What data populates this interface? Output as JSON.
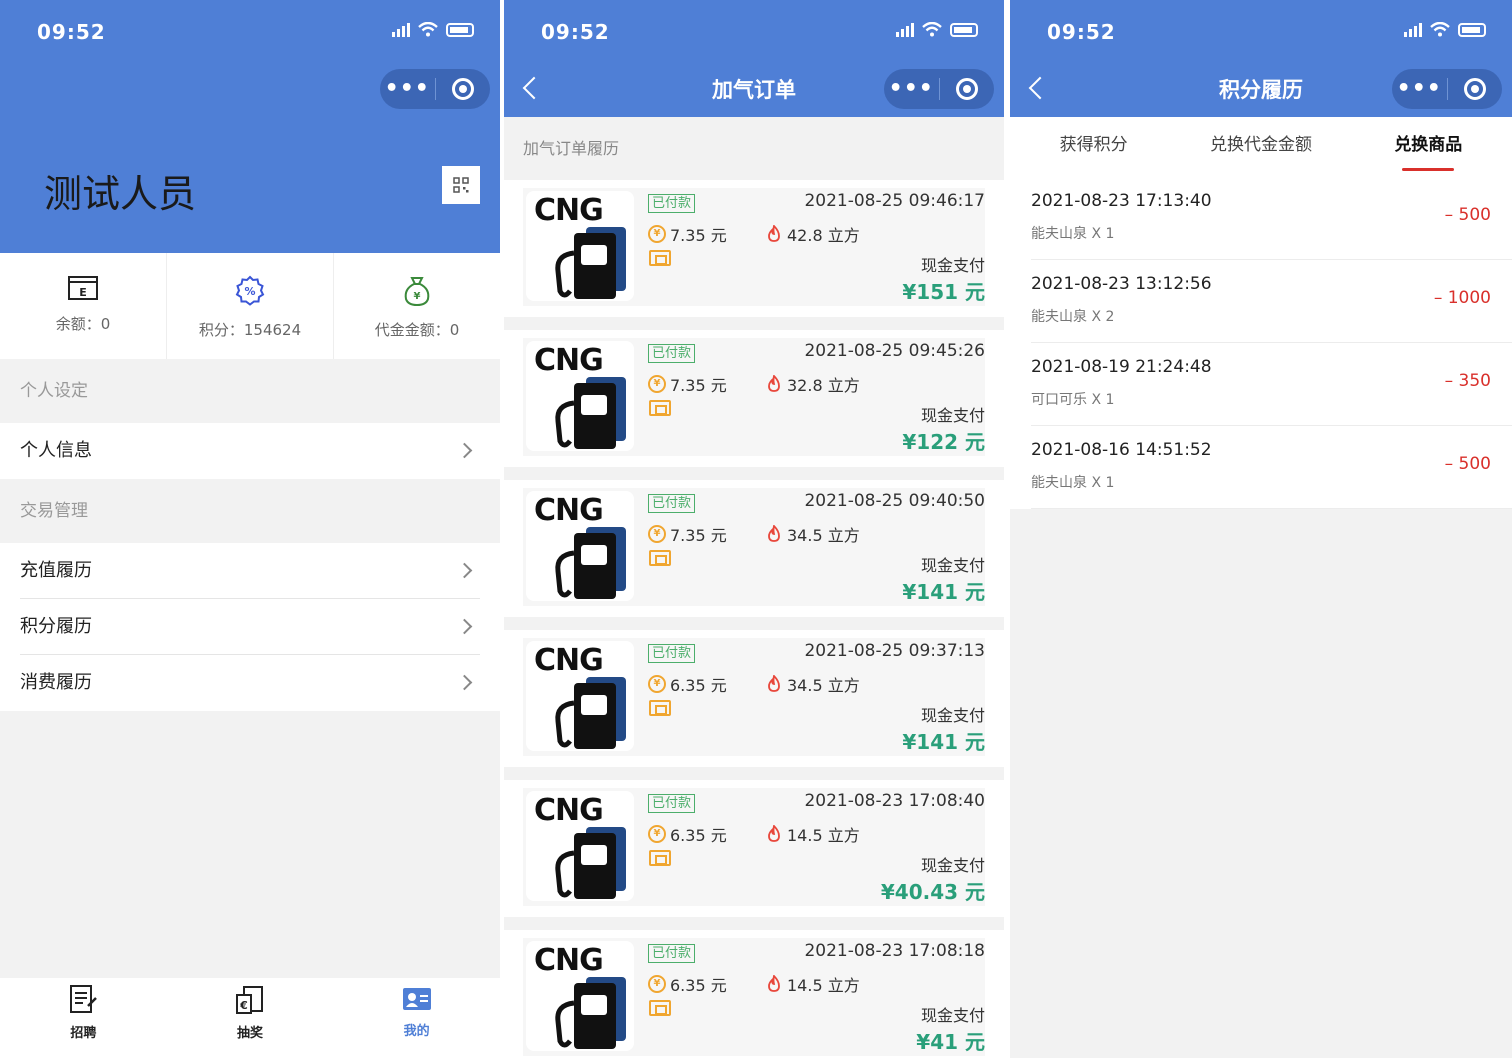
{
  "status_time": "09:52",
  "profile": {
    "user_name": "测试人员",
    "stats": [
      {
        "label": "余额：0",
        "icon": "card-e-icon",
        "color": "#222222"
      },
      {
        "label": "积分：154624",
        "icon": "percent-badge-icon",
        "color": "#3a55d6"
      },
      {
        "label": "代金金额：0",
        "icon": "money-bag-icon",
        "color": "#3b8a3b"
      }
    ],
    "section_personal": "个人设定",
    "row_personal_info": "个人信息",
    "section_trade": "交易管理",
    "row_recharge": "充值履历",
    "row_points": "积分履历",
    "row_consume": "消费履历",
    "tabbar": {
      "tab1": "招聘",
      "tab2": "抽奖",
      "tab3": "我的"
    }
  },
  "orders_page": {
    "title": "加气订单",
    "subheader": "加气订单履历",
    "logo_text": "CNG",
    "orders": [
      {
        "status": "已付款",
        "price": "7.35 元",
        "volume": "42.8 立方",
        "datetime": "2021-08-25 09:46:17",
        "payment": "现金支付",
        "total": "¥151 元"
      },
      {
        "status": "已付款",
        "price": "7.35 元",
        "volume": "32.8 立方",
        "datetime": "2021-08-25 09:45:26",
        "payment": "现金支付",
        "total": "¥122 元"
      },
      {
        "status": "已付款",
        "price": "7.35 元",
        "volume": "34.5 立方",
        "datetime": "2021-08-25 09:40:50",
        "payment": "现金支付",
        "total": "¥141 元"
      },
      {
        "status": "已付款",
        "price": "6.35 元",
        "volume": "34.5 立方",
        "datetime": "2021-08-25 09:37:13",
        "payment": "现金支付",
        "total": "¥141 元"
      },
      {
        "status": "已付款",
        "price": "6.35 元",
        "volume": "14.5 立方",
        "datetime": "2021-08-23 17:08:40",
        "payment": "现金支付",
        "total": "¥40.43 元"
      },
      {
        "status": "已付款",
        "price": "6.35 元",
        "volume": "14.5 立方",
        "datetime": "2021-08-23 17:08:18",
        "payment": "现金支付",
        "total": "¥41 元"
      }
    ]
  },
  "points_page": {
    "title": "积分履历",
    "tabs": [
      "获得积分",
      "兑换代金金额",
      "兑换商品"
    ],
    "active_tab": "兑换商品",
    "records": [
      {
        "datetime": "2021-08-23 17:13:40",
        "item": "能夫山泉 X 1",
        "points": "– 500"
      },
      {
        "datetime": "2021-08-23 13:12:56",
        "item": "能夫山泉 X 2",
        "points": "– 1000"
      },
      {
        "datetime": "2021-08-19 21:24:48",
        "item": "可口可乐 X 1",
        "points": "– 350"
      },
      {
        "datetime": "2021-08-16 14:51:52",
        "item": "能夫山泉 X 1",
        "points": "– 500"
      }
    ]
  },
  "colors": {
    "brand_blue": "#4f7fd6",
    "paid_green": "#4cae6b",
    "total_green": "#2a9f7a",
    "points_red": "#d9302b",
    "coin_orange": "#f0a630"
  }
}
